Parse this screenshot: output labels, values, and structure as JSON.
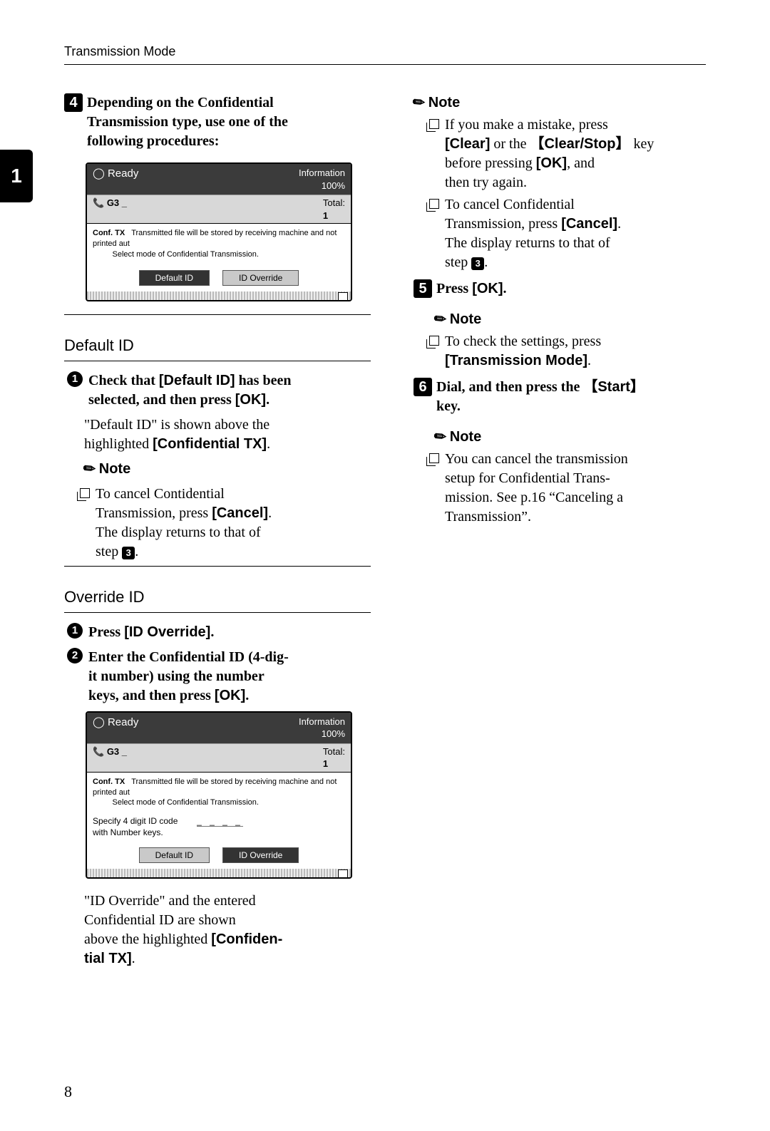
{
  "running_head": "Transmission Mode",
  "edge_tab": "1",
  "page_number": "8",
  "step4": {
    "num": "4",
    "text_a": "Depending on the Confidential",
    "text_b": "Transmission type, use one of the",
    "text_c": "following procedures:"
  },
  "screen_common": {
    "ready": "Ready",
    "info": "Information",
    "pct": "100%",
    "g3": "G3",
    "total_lbl": "Total:",
    "total_val": "1",
    "conf": "Conf. TX",
    "msg1": "Transmitted file will be stored by receiving machine and not printed aut",
    "msg2": "Select mode of Confidential Transmission.",
    "btn_default": "Default ID",
    "btn_override": "ID Override"
  },
  "screen2_extra": {
    "label_a": "Specify 4 digit ID code",
    "label_b": "with Number keys.",
    "dashes": "_ _ _ _"
  },
  "sec_default": {
    "head": "Default ID",
    "b1_num": "1",
    "b1_a": "Check that ",
    "b1_key": "[Default ID]",
    "b1_b": " has been",
    "b1_c": "selected, and then press ",
    "b1_key2": "[OK]",
    "b1_d": ".",
    "para_a": "\"Default ID\" is shown above the",
    "para_b": "highlighted ",
    "para_key": "[Confidential TX]",
    "para_c": ".",
    "note": "Note",
    "n1_a": "To cancel Contidential",
    "n1_b": "Transmission, press ",
    "n1_key": "[Cancel]",
    "n1_c": ".",
    "n1_d": "The display returns to that of",
    "n1_e": "step ",
    "n1_ref": "3",
    "n1_f": "."
  },
  "sec_override": {
    "head": "Override ID",
    "b1_num": "1",
    "b1_a": "Press ",
    "b1_key": "[ID Override]",
    "b1_b": ".",
    "b2_num": "2",
    "b2_a": "Enter the Confidential ID (4-dig-",
    "b2_b": "it number) using the number",
    "b2_c": "keys, and then press ",
    "b2_key": "[OK]",
    "b2_d": ".",
    "para_a": "\"ID Override\" and the entered",
    "para_b": "Confidential ID are shown",
    "para_c": "above the highlighted ",
    "para_key": "[Confiden-",
    "para_key2": "tial TX]",
    "para_d": "."
  },
  "right": {
    "note": "Note",
    "r1_a": "If you make a mistake, press",
    "r1_key1": "[Clear]",
    "r1_b": " or the ",
    "r1_key2": "Clear/Stop",
    "r1_c": " key",
    "r1_d": "before pressing ",
    "r1_key3": "[OK]",
    "r1_e": ", and",
    "r1_f": "then try again.",
    "r2_a": "To cancel Confidential",
    "r2_b": "Transmission, press ",
    "r2_key": "[Cancel]",
    "r2_c": ".",
    "r2_d": "The display returns to that of",
    "r2_e": "step ",
    "r2_ref": "3",
    "r2_f": ".",
    "step5_num": "5",
    "step5_a": "Press ",
    "step5_key": "[OK]",
    "step5_b": ".",
    "s5_note": "Note",
    "s5_n_a": "To check the settings, press",
    "s5_n_key": "[Transmission Mode]",
    "s5_n_b": ".",
    "step6_num": "6",
    "step6_a": "Dial, and then press the ",
    "step6_key": "Start",
    "step6_b": "key.",
    "s6_note": "Note",
    "s6_n_a": "You can cancel the transmission",
    "s6_n_b": "setup for Confidential Trans-",
    "s6_n_c": "mission. See p.16 “Canceling a",
    "s6_n_d": "Transmission”."
  }
}
